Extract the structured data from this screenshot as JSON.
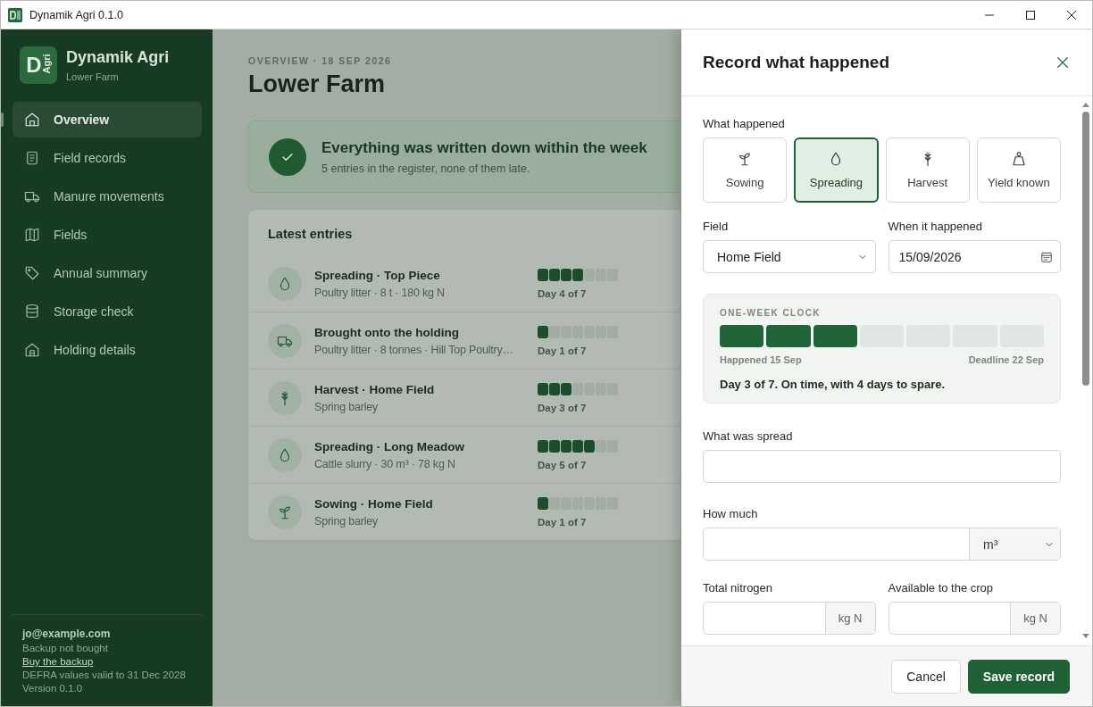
{
  "window": {
    "title": "Dynamik Agri 0.1.0"
  },
  "sidebar": {
    "logo_letter": "D",
    "logo_word": "Agri",
    "app_name": "Dynamik Agri",
    "farm": "Lower Farm",
    "items": [
      {
        "label": "Overview",
        "kind": "home",
        "selected": true
      },
      {
        "label": "Field records",
        "kind": "document",
        "selected": false
      },
      {
        "label": "Manure movements",
        "kind": "truck",
        "selected": false
      },
      {
        "label": "Fields",
        "kind": "map",
        "selected": false
      },
      {
        "label": "Annual summary",
        "kind": "tag",
        "selected": false
      },
      {
        "label": "Storage check",
        "kind": "storage",
        "selected": false
      },
      {
        "label": "Holding details",
        "kind": "building",
        "selected": false
      }
    ],
    "footer": {
      "email": "jo@example.com",
      "backup_status": "Backup not bought",
      "backup_link": "Buy the backup",
      "defra": "DEFRA values valid to 31 Dec 2028",
      "version": "Version 0.1.0"
    }
  },
  "overview": {
    "eyebrow": "OVERVIEW · 18 SEP 2026",
    "title": "Lower Farm",
    "banner": {
      "title": "Everything was written down within the week",
      "text": "5 entries in the register, none of them late."
    },
    "latest": {
      "heading": "Latest entries",
      "entries": [
        {
          "kind": "drop",
          "title": "Spreading · Top Piece",
          "detail": "Poultry litter · 8 t · 180 kg N",
          "level": 0.5714,
          "day": "Day 4 of 7"
        },
        {
          "kind": "truck",
          "title": "Brought onto the holding",
          "detail": "Poultry litter · 8 tonnes · Hill Top Poultry…",
          "level": 0.1429,
          "day": "Day 1 of 7"
        },
        {
          "kind": "wheat",
          "title": "Harvest · Home Field",
          "detail": "Spring barley",
          "level": 0.4286,
          "day": "Day 3 of 7"
        },
        {
          "kind": "drop",
          "title": "Spreading · Long Meadow",
          "detail": "Cattle slurry · 30 m³ · 78 kg N",
          "level": 0.7143,
          "day": "Day 5 of 7"
        },
        {
          "kind": "sprout",
          "title": "Sowing · Home Field",
          "detail": "Spring barley",
          "level": 0.1429,
          "day": "Day 1 of 7"
        }
      ]
    }
  },
  "drawer": {
    "title": "Record what happened",
    "what_label": "What happened",
    "event_types": [
      {
        "label": "Sowing",
        "kind": "sprout",
        "selected": false
      },
      {
        "label": "Spreading",
        "kind": "drop",
        "selected": true
      },
      {
        "label": "Harvest",
        "kind": "wheat",
        "selected": false
      },
      {
        "label": "Yield known",
        "kind": "weight",
        "selected": false
      }
    ],
    "field": {
      "label": "Field",
      "value": "Home Field"
    },
    "date": {
      "label": "When it happened",
      "value": "15/09/2026"
    },
    "clock": {
      "label": "ONE-WEEK CLOCK",
      "level": 0.4286,
      "start": "Happened 15 Sep",
      "end": "Deadline 22 Sep",
      "message": "Day 3 of 7. On time, with 4 days to spare."
    },
    "material": {
      "label": "What was spread"
    },
    "amount": {
      "label": "How much",
      "unit": "m³"
    },
    "total_n": {
      "label": "Total nitrogen",
      "unit": "kg N"
    },
    "available_n": {
      "label": "Available to the crop",
      "unit": "kg N"
    },
    "buttons": [
      {
        "label": "Cancel",
        "kind": "secondary"
      },
      {
        "label": "Save record",
        "kind": "primary"
      }
    ]
  }
}
